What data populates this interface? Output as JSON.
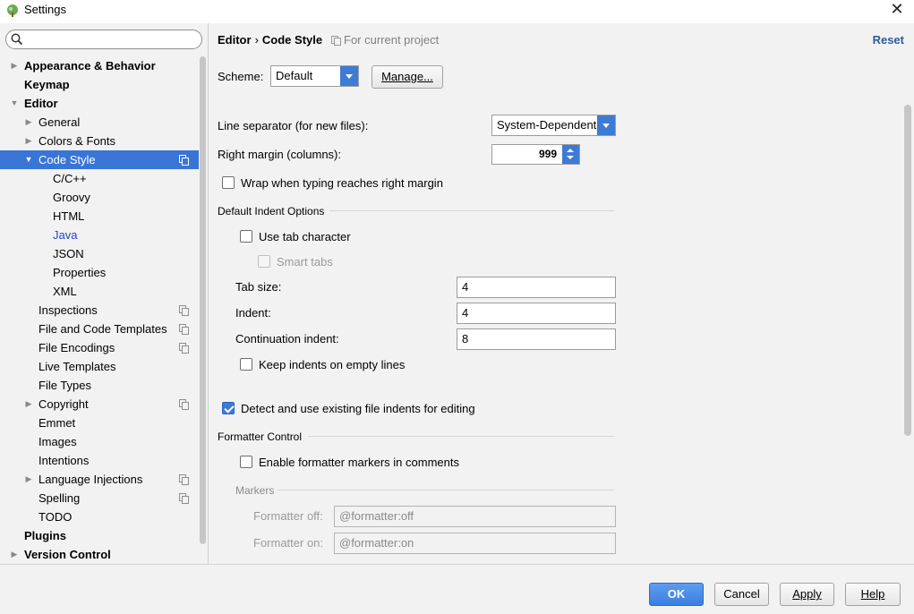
{
  "window": {
    "title": "Settings"
  },
  "search": {
    "placeholder": ""
  },
  "tree": [
    {
      "label": "Appearance & Behavior",
      "level": 0,
      "arrow": "right",
      "bold": true
    },
    {
      "label": "Keymap",
      "level": 0,
      "arrow": "",
      "bold": true
    },
    {
      "label": "Editor",
      "level": 0,
      "arrow": "down",
      "bold": true
    },
    {
      "label": "General",
      "level": 1,
      "arrow": "right"
    },
    {
      "label": "Colors & Fonts",
      "level": 1,
      "arrow": "right"
    },
    {
      "label": "Code Style",
      "level": 1,
      "arrow": "down",
      "selected": true,
      "project": true
    },
    {
      "label": "C/C++",
      "level": 2
    },
    {
      "label": "Groovy",
      "level": 2
    },
    {
      "label": "HTML",
      "level": 2
    },
    {
      "label": "Java",
      "level": 2,
      "link": true
    },
    {
      "label": "JSON",
      "level": 2
    },
    {
      "label": "Properties",
      "level": 2
    },
    {
      "label": "XML",
      "level": 2
    },
    {
      "label": "Inspections",
      "level": 1,
      "project": true
    },
    {
      "label": "File and Code Templates",
      "level": 1,
      "project": true
    },
    {
      "label": "File Encodings",
      "level": 1,
      "project": true
    },
    {
      "label": "Live Templates",
      "level": 1
    },
    {
      "label": "File Types",
      "level": 1
    },
    {
      "label": "Copyright",
      "level": 1,
      "arrow": "right",
      "project": true
    },
    {
      "label": "Emmet",
      "level": 1
    },
    {
      "label": "Images",
      "level": 1
    },
    {
      "label": "Intentions",
      "level": 1
    },
    {
      "label": "Language Injections",
      "level": 1,
      "arrow": "right",
      "project": true
    },
    {
      "label": "Spelling",
      "level": 1,
      "project": true
    },
    {
      "label": "TODO",
      "level": 1
    },
    {
      "label": "Plugins",
      "level": 0,
      "bold": true
    },
    {
      "label": "Version Control",
      "level": 0,
      "arrow": "right",
      "bold": true
    }
  ],
  "header": {
    "crumb_parent": "Editor",
    "crumb_sep": "›",
    "crumb_current": "Code Style",
    "for_project": "For current project",
    "reset": "Reset"
  },
  "scheme": {
    "label": "Scheme:",
    "value": "Default",
    "manage": "Manage..."
  },
  "form": {
    "line_sep_label": "Line separator (for new files):",
    "line_sep_value": "System-Dependent",
    "right_margin_label": "Right margin (columns):",
    "right_margin_value": "999",
    "wrap_label": "Wrap when typing reaches right margin",
    "indent_section": "Default Indent Options",
    "use_tab_label": "Use tab character",
    "smart_tabs_label": "Smart tabs",
    "tab_size_label": "Tab size:",
    "tab_size_value": "4",
    "indent_label": "Indent:",
    "indent_value": "4",
    "cont_indent_label": "Continuation indent:",
    "cont_indent_value": "8",
    "keep_indents_label": "Keep indents on empty lines",
    "detect_label": "Detect and use existing file indents for editing",
    "formatter_section": "Formatter Control",
    "enable_markers_label": "Enable formatter markers in comments",
    "markers_section": "Markers",
    "formatter_off_label": "Formatter off:",
    "formatter_off_value": "@formatter:off",
    "formatter_on_label": "Formatter on:",
    "formatter_on_value": "@formatter:on"
  },
  "checks": {
    "wrap": false,
    "use_tab": false,
    "smart_tabs": false,
    "keep_indents": false,
    "detect": true,
    "enable_markers": false
  },
  "footer": {
    "ok": "OK",
    "cancel": "Cancel",
    "apply": "Apply",
    "help": "Help"
  },
  "colors": {
    "accent": "#3875d7",
    "link": "#2346c8",
    "reset": "#2f5a9f"
  }
}
